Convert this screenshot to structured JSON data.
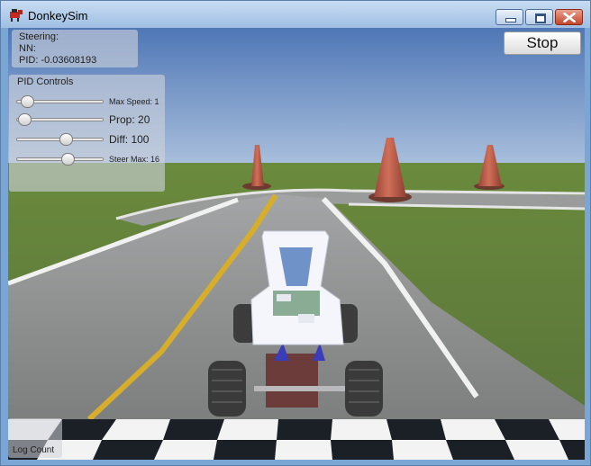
{
  "window": {
    "title": "DonkeySim",
    "app_icon": "donkey-app-icon",
    "controls": [
      "minimize-icon",
      "maximize-icon",
      "close-icon"
    ]
  },
  "status_panel": {
    "steering_label": "Steering:",
    "nn_label": "NN:",
    "pid_label": "PID: -0.03608193"
  },
  "stop_button": {
    "label": "Stop"
  },
  "pid_controls": {
    "title": "PID Controls",
    "sliders": [
      {
        "label": "Max Speed: 1",
        "position": 0.06
      },
      {
        "label": "Prop: 20",
        "position": 0.03
      },
      {
        "label": "Diff: 100",
        "position": 0.59
      },
      {
        "label": "Steer Max: 16",
        "position": 0.61
      }
    ]
  },
  "log_count": {
    "label": "Log Count"
  },
  "colors": {
    "sky": "#6f93c8",
    "grass": "#6f8b43",
    "road": "#8a8a88",
    "center_line": "#d9b12d",
    "cone": "#b85a45",
    "car_body": "#f2f4f8",
    "titlebar": "#b3cdea"
  }
}
